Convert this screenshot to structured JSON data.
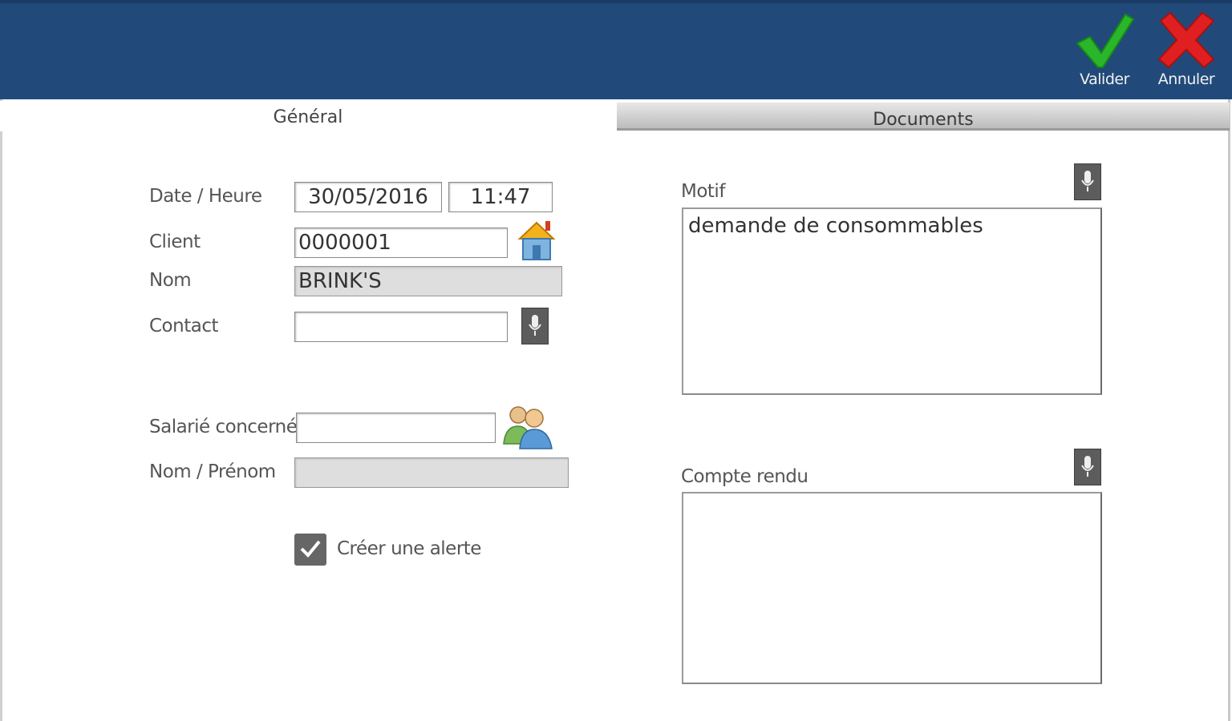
{
  "header": {
    "valider_label": "Valider",
    "annuler_label": "Annuler"
  },
  "tabs": {
    "general": "Général",
    "documents": "Documents"
  },
  "form": {
    "date_heure_label": "Date / Heure",
    "date_value": "30/05/2016",
    "time_value": "11:47",
    "client_label": "Client",
    "client_value": "0000001",
    "nom_label": "Nom",
    "nom_value": "BRINK'S",
    "contact_label": "Contact",
    "contact_value": "",
    "salarie_label": "Salarié concerné",
    "salarie_value": "",
    "nom_prenom_label": "Nom / Prénom",
    "nom_prenom_value": "",
    "alert_label": "Créer une alerte",
    "alert_checked": true
  },
  "motif": {
    "label": "Motif",
    "value": "demande de consommables"
  },
  "compte_rendu": {
    "label": "Compte rendu",
    "value": ""
  },
  "colors": {
    "header_bg": "#214a7a",
    "valider_green": "#2bb52b",
    "annuler_red": "#e02020"
  }
}
